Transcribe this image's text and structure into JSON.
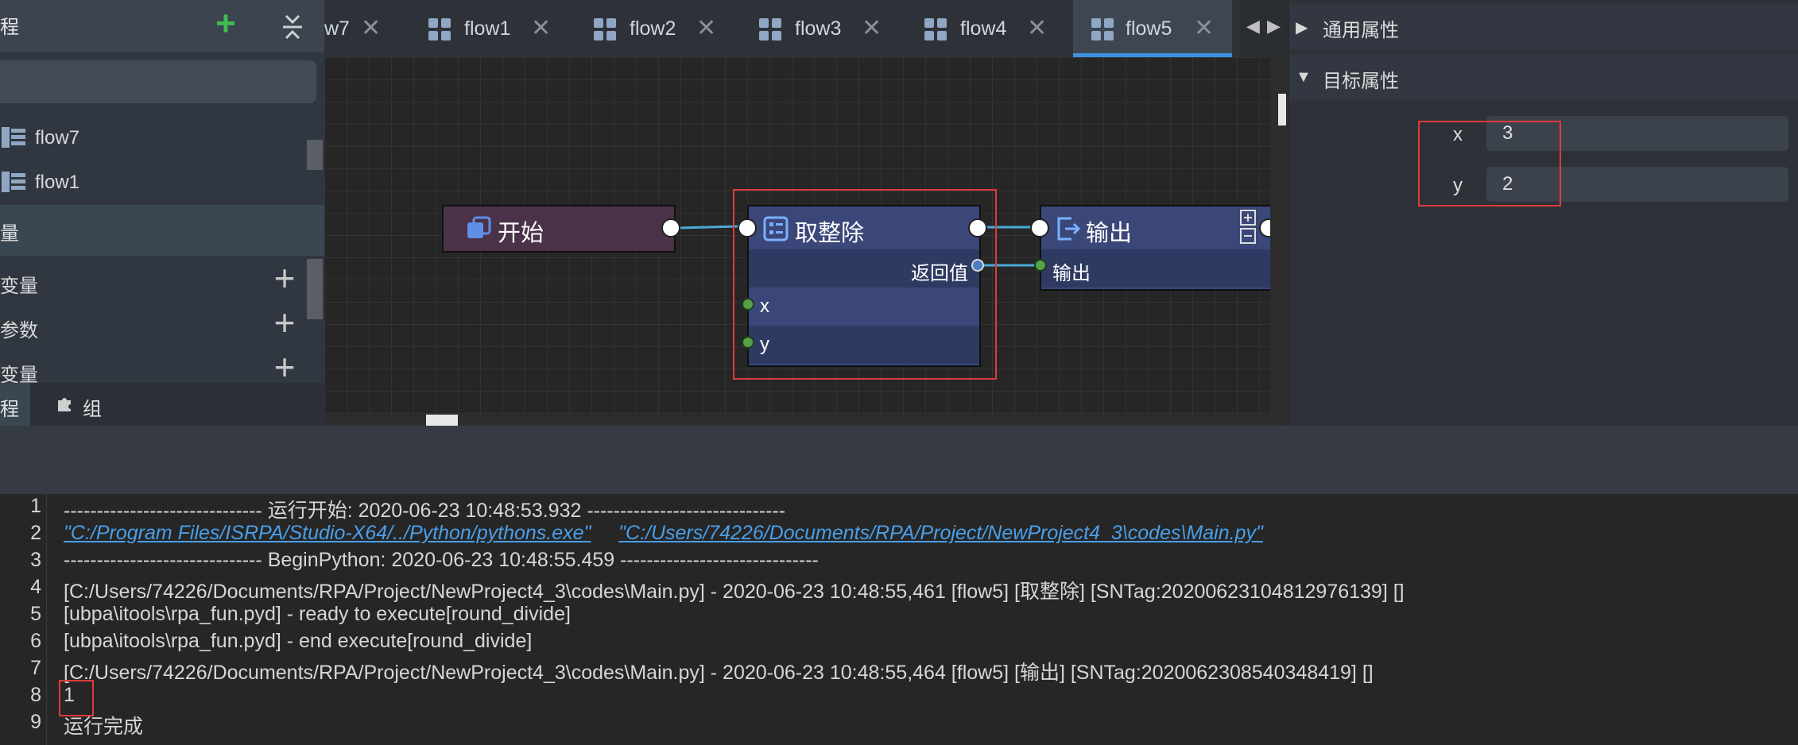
{
  "left_panel": {
    "header_title": "程",
    "tree_items": [
      {
        "label": "flow7"
      },
      {
        "label": "flow1"
      }
    ],
    "variables_header": "量",
    "var_rows": [
      {
        "label": "变量"
      },
      {
        "label": "参数"
      },
      {
        "label": "变量"
      }
    ],
    "bottom_tabs": {
      "flow_tab": "程",
      "components_tab": "组件"
    }
  },
  "tabs": [
    {
      "label": "w7",
      "active": false
    },
    {
      "label": "flow1",
      "active": false
    },
    {
      "label": "flow2",
      "active": false
    },
    {
      "label": "flow3",
      "active": false
    },
    {
      "label": "flow4",
      "active": false
    },
    {
      "label": "flow5",
      "active": true
    }
  ],
  "tab_nav": {
    "prev": "◀",
    "next": "▶"
  },
  "canvas": {
    "node_start": {
      "title": "开始"
    },
    "node_divide": {
      "title": "取整除",
      "return_label": "返回值",
      "inputs": [
        "x",
        "y"
      ]
    },
    "node_output": {
      "title": "输出",
      "input_label": "输出"
    }
  },
  "properties": {
    "general_group": "通用属性",
    "target_group": "目标属性",
    "fields": [
      {
        "key": "x",
        "value": "3"
      },
      {
        "key": "y",
        "value": "2"
      }
    ]
  },
  "console": {
    "lines": [
      {
        "n": "1",
        "text": "------------------------------ 运行开始: 2020-06-23 10:48:53.932 ------------------------------"
      },
      {
        "n": "2",
        "link1": "\"C:/Program Files/ISRPA/Studio-X64/../Python/pythons.exe\"",
        "link2": "\"C:/Users/74226/Documents/RPA/Project/NewProject4_3\\codes\\Main.py\""
      },
      {
        "n": "3",
        "text": "------------------------------ BeginPython: 2020-06-23 10:48:55.459 ------------------------------"
      },
      {
        "n": "4",
        "text": "[C:/Users/74226/Documents/RPA/Project/NewProject4_3\\codes\\Main.py] - 2020-06-23 10:48:55,461  [flow5] [取整除]  [SNTag:2020062310481297613­9]  []"
      },
      {
        "n": "5",
        "text": "[ubpa\\itools\\rpa_fun.pyd] - ready to execute[round_divide]"
      },
      {
        "n": "6",
        "text": "[ubpa\\itools\\rpa_fun.pyd] - end execute[round_divide]"
      },
      {
        "n": "7",
        "text": "[C:/Users/74226/Documents/RPA/Project/NewProject4_3\\codes\\Main.py] - 2020-06-23 10:48:55,464  [flow5] [输出]  [SNTag:2020062308540348419]  []"
      },
      {
        "n": "8",
        "text": "1"
      },
      {
        "n": "9",
        "text": "运行完成"
      }
    ]
  },
  "colors": {
    "accent": "#3d8fe0",
    "highlight": "#e03a3a",
    "add_green": "#3fbf4f",
    "node_blue": "#3b4778",
    "node_start": "#4a3248"
  }
}
